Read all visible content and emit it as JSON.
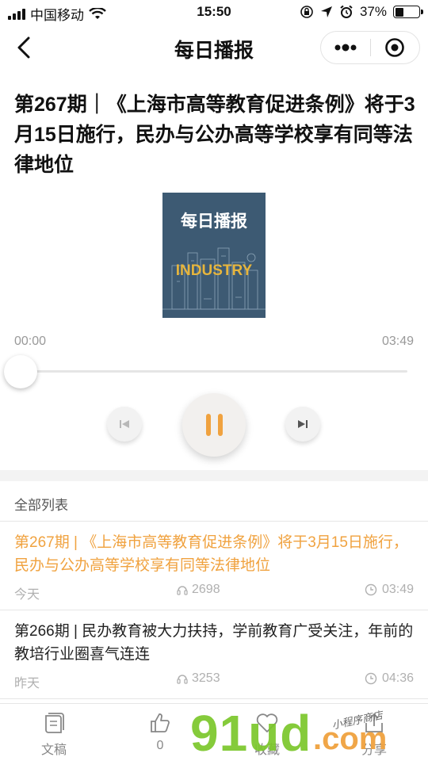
{
  "status_bar": {
    "carrier": "中国移动",
    "time": "15:50",
    "battery_percent": "37%",
    "battery_level": 0.37
  },
  "nav": {
    "title": "每日播报",
    "back_icon": "chevron-left-icon",
    "more_icon": "more-dots-icon",
    "close_icon": "target-circle-icon"
  },
  "article": {
    "title": "第267期｜《上海市高等教育促进条例》将于3月15日施行，民办与公办高等学校享有同等法律地位"
  },
  "cover": {
    "title": "每日播报",
    "subtitle": "INDUSTRY"
  },
  "player": {
    "current_time": "00:00",
    "total_time": "03:49",
    "progress": 0,
    "state": "playing"
  },
  "list": {
    "header": "全部列表",
    "items": [
      {
        "title": "第267期 | 《上海市高等教育促进条例》将于3月15日施行，民办与公办高等学校享有同等法律地位",
        "day": "今天",
        "plays": "2698",
        "duration": "03:49",
        "active": true
      },
      {
        "title": "第266期 | 民办教育被大力扶持，学前教育广受关注，年前的教培行业圈喜气连连",
        "day": "昨天",
        "plays": "3253",
        "duration": "04:36",
        "active": false
      }
    ]
  },
  "tabbar": {
    "items": [
      {
        "label": "文稿",
        "icon": "document-icon"
      },
      {
        "label": "0",
        "icon": "thumbs-up-icon"
      },
      {
        "label": "收藏",
        "icon": "heart-icon"
      },
      {
        "label": "分享",
        "icon": "share-icon"
      }
    ]
  },
  "watermark": {
    "brand": "91ud",
    "suffix": ".com",
    "handwriting": "小程序商店"
  },
  "colors": {
    "accent": "#f0a23f",
    "cover_bg": "#3d5a73",
    "cover_accent": "#e6b53d",
    "watermark_green": "#7bc72b"
  }
}
